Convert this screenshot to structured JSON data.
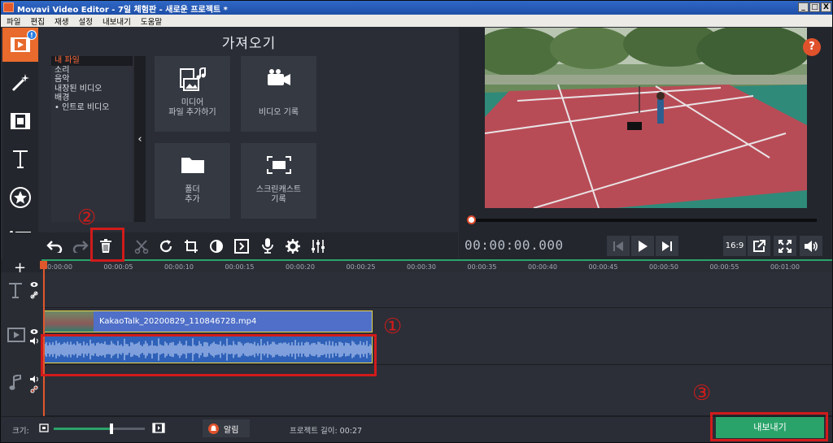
{
  "window": {
    "title": "Movavi Video Editor - 7일 체험판 - 새로운 프로젝트 *",
    "controls": [
      "_",
      "□",
      "X"
    ]
  },
  "menu": [
    "파일",
    "편집",
    "재생",
    "설정",
    "내보내기",
    "도움말"
  ],
  "rail": {
    "badge": "!",
    "items": [
      "import-icon",
      "magic-wand-icon",
      "filters-icon",
      "titles-icon",
      "stickers-icon",
      "more-icon"
    ]
  },
  "import": {
    "title": "가져오기",
    "sources": [
      "내 파일",
      "소리",
      "음악",
      "내장된 비디오",
      "배경",
      "• 인트로 비디오"
    ],
    "collapse": "‹",
    "tiles": [
      {
        "label1": "미디어",
        "label2": "파일 추가하기"
      },
      {
        "label1": "비디오 기록",
        "label2": ""
      },
      {
        "label1": "폴더",
        "label2": "추가"
      },
      {
        "label1": "스크린캐스트",
        "label2": "기록"
      }
    ]
  },
  "preview": {
    "help": "?",
    "timecode": "00:00:00.000",
    "aspect": "16:9",
    "progress": 0
  },
  "ruler": [
    "00:00:00",
    "00:00:05",
    "00:00:10",
    "00:00:15",
    "00:00:20",
    "00:00:25",
    "00:00:30",
    "00:00:35",
    "00:00:40",
    "00:00:45",
    "00:00:50",
    "00:00:55",
    "00:01:00"
  ],
  "timeline": {
    "add": "+",
    "clip_name": "KakaoTalk_20200829_110846728.mp4"
  },
  "footer": {
    "scale_label": "크기:",
    "zoom_level": 0.63,
    "notify_label": "알림",
    "project_length": "프로젝트 길이:  00:27",
    "export_label": "내보내기"
  },
  "annotations": [
    "①",
    "②",
    "③"
  ],
  "colors": {
    "accent": "#e86a2c",
    "export": "#2aa36a",
    "clip": "#4f6fc8",
    "annotation": "#d11b1b"
  }
}
